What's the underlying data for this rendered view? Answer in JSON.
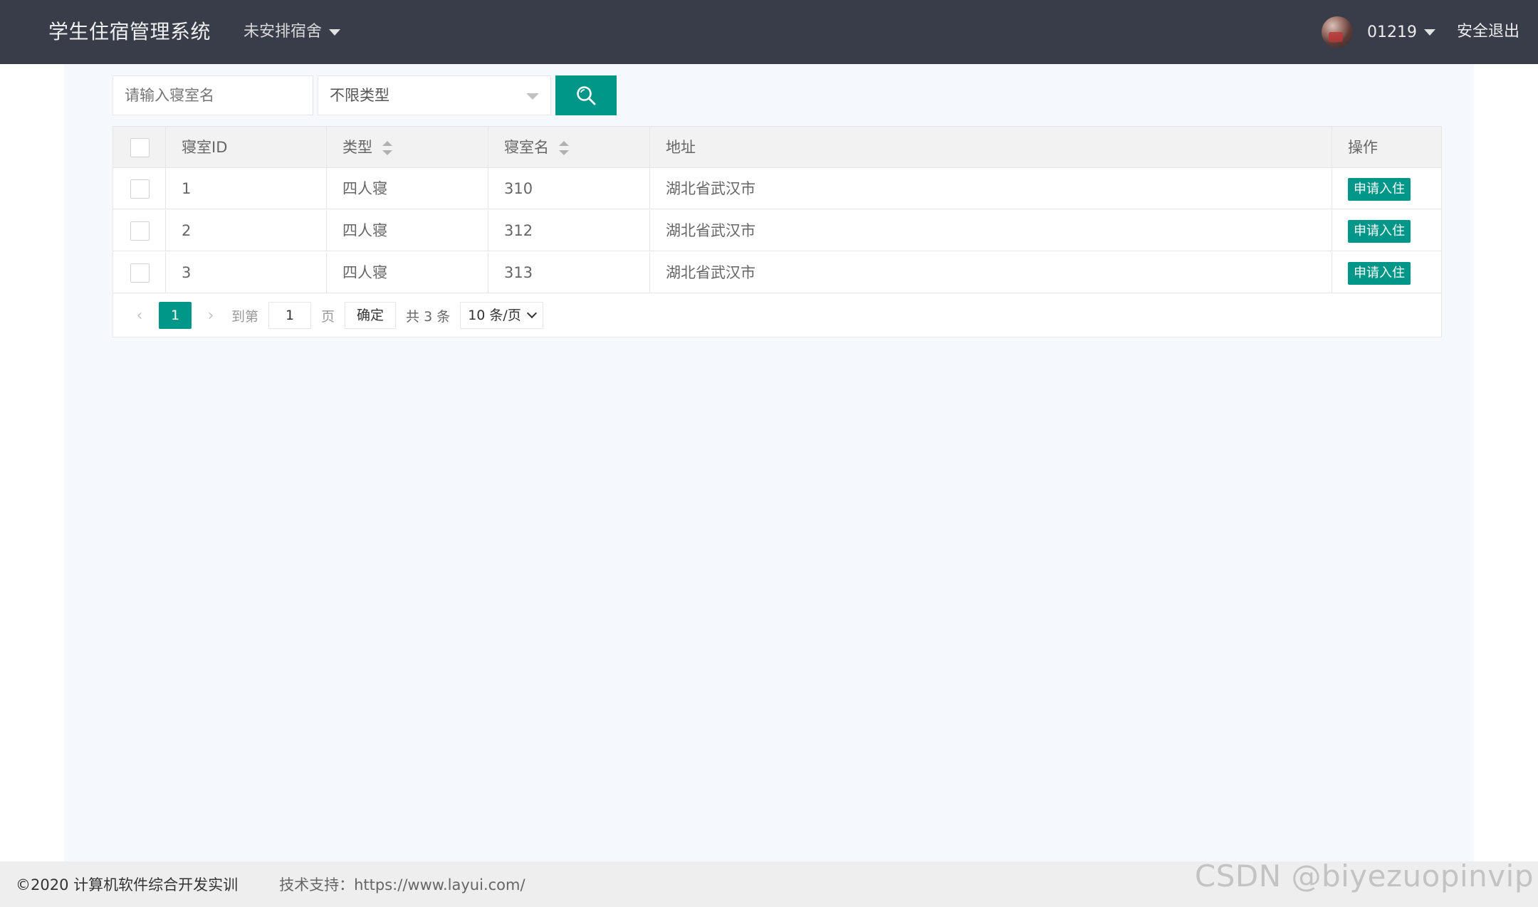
{
  "header": {
    "logo": "学生住宿管理系统",
    "nav_menu_label": "未安排宿舍",
    "user_name": "01219",
    "logout_label": "安全退出"
  },
  "toolbar": {
    "search_placeholder": "请输入寝室名",
    "type_select_value": "不限类型"
  },
  "table": {
    "columns": {
      "id": "寝室ID",
      "type": "类型",
      "name": "寝室名",
      "address": "地址",
      "action": "操作"
    },
    "rows": [
      {
        "id": "1",
        "type": "四人寝",
        "name": "310",
        "address": "湖北省武汉市",
        "action": "申请入住"
      },
      {
        "id": "2",
        "type": "四人寝",
        "name": "312",
        "address": "湖北省武汉市",
        "action": "申请入住"
      },
      {
        "id": "3",
        "type": "四人寝",
        "name": "313",
        "address": "湖北省武汉市",
        "action": "申请入住"
      }
    ]
  },
  "pagination": {
    "prev_glyph": "‹",
    "current_page": "1",
    "next_glyph": "›",
    "goto_label": "到第",
    "goto_value": "1",
    "page_unit": "页",
    "confirm_label": "确定",
    "total_text": "共 3 条",
    "page_size": "10 条/页"
  },
  "footer": {
    "copyright": "©2020 计算机软件综合开发实训",
    "support": "技术支持：https://www.layui.com/"
  },
  "watermark": "CSDN @biyezuopinvip",
  "colors": {
    "header_bg": "#393D49",
    "accent": "#009688",
    "body_bg": "#F5F9FD",
    "footer_bg": "#EEEEEE"
  }
}
